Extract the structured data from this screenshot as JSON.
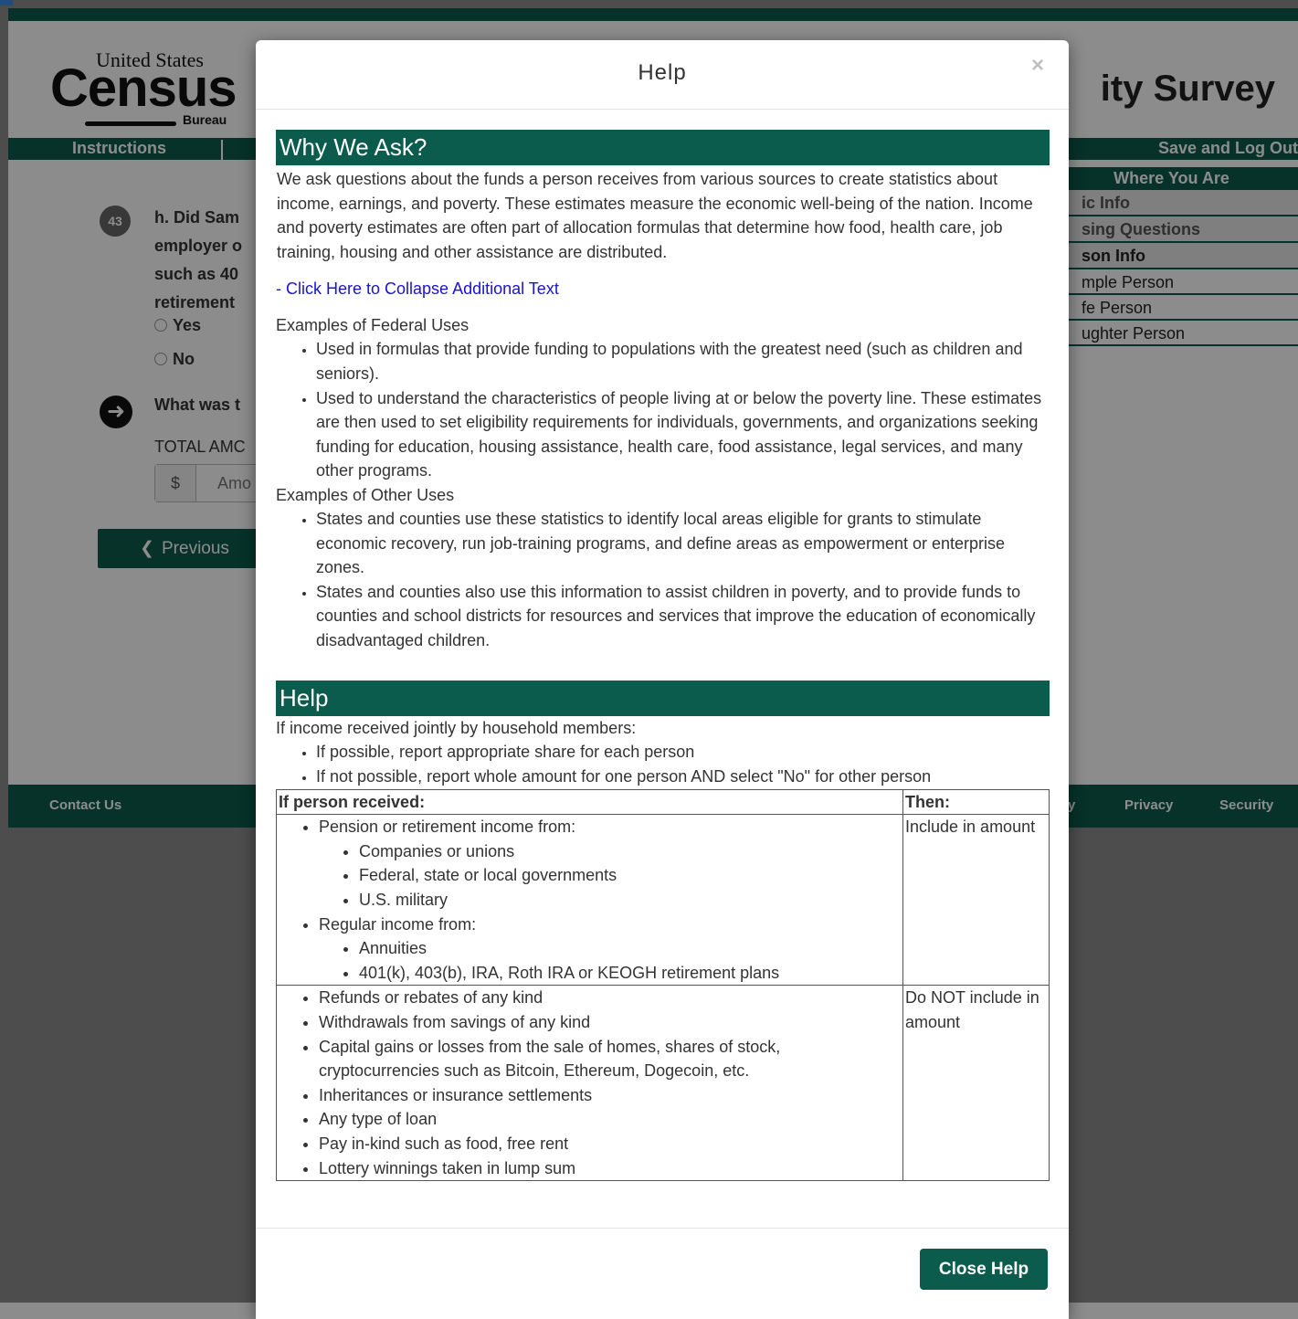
{
  "background": {
    "logo": {
      "top": "United States",
      "main": "Census",
      "bottom": "Bureau"
    },
    "survey_title_visible": "ity Survey",
    "nav": {
      "instructions": "Instructions",
      "save_logout": "Save and Log Out"
    },
    "where_you_are": {
      "heading": "Where You Are",
      "items": [
        {
          "label": "ic Info",
          "style": "bold-muted"
        },
        {
          "label": "sing Questions",
          "style": "bold-muted"
        },
        {
          "label": "son Info",
          "style": "bold"
        },
        {
          "label": "mple Person",
          "style": "plain"
        },
        {
          "label": "fe Person",
          "style": "plain"
        },
        {
          "label": "ughter Person",
          "style": "plain"
        }
      ]
    },
    "question": {
      "number": "43",
      "lines": [
        "h. Did Sam",
        "employer o",
        "such as 40",
        "retirement"
      ],
      "options": [
        "Yes",
        "No"
      ]
    },
    "followup": {
      "text": "What was t",
      "total_label": "TOTAL AMC",
      "currency": "$",
      "placeholder": "Amo"
    },
    "previous_button": "Previous",
    "footer": {
      "contact": "Contact Us",
      "partial": "y",
      "privacy": "Privacy",
      "security": "Security"
    }
  },
  "modal": {
    "title": "Help",
    "close_symbol": "×",
    "why_heading": "Why We Ask?",
    "why_text": "We ask questions about the funds a person receives from various sources to create statistics about income, earnings, and poverty. These estimates measure the economic well-being of the nation. Income and poverty estimates are often part of allocation formulas that determine how food, health care, job training, housing and other assistance are distributed.",
    "collapse_link": "- Click Here to Collapse Additional Text",
    "federal_heading": "Examples of Federal Uses",
    "federal_uses": [
      "Used in formulas that provide funding to populations with the greatest need (such as children and seniors).",
      "Used to understand the characteristics of people living at or below the poverty line. These estimates are then used to set eligibility requirements for individuals, governments, and organizations seeking funding for education, housing assistance, health care, food assistance, legal services, and many other programs."
    ],
    "other_heading": "Examples of Other Uses",
    "other_uses": [
      "States and counties use these statistics to identify local areas eligible for grants to stimulate economic recovery, run job-training programs, and define areas as empowerment or enterprise zones.",
      "States and counties also use this information to assist children in poverty, and to provide funds to counties and school districts for resources and services that improve the education of economically disadvantaged children."
    ],
    "help_heading": "Help",
    "help_intro": "If income received jointly by household members:",
    "help_bullets": [
      "If possible, report appropriate share for each person",
      "If not possible, report whole amount for one person AND select \"No\" for other person"
    ],
    "table": {
      "header": {
        "col1": "If person received:",
        "col2": "Then:"
      },
      "row1": {
        "pension_label": "Pension or retirement income from:",
        "pension_items": [
          "Companies or unions",
          "Federal, state or local governments",
          "U.S. military"
        ],
        "regular_label": "Regular income from:",
        "regular_items": [
          "Annuities",
          "401(k), 403(b), IRA, Roth IRA or KEOGH retirement plans"
        ],
        "then": "Include in amount"
      },
      "row2": {
        "items": [
          "Refunds or rebates of any kind",
          "Withdrawals from savings of any kind",
          "Capital gains or losses from the sale of homes, shares of stock, cryptocurrencies such as Bitcoin, Ethereum, Dogecoin, etc.",
          "Inheritances or insurance settlements",
          "Any type of loan",
          "Pay in-kind such as food, free rent",
          "Lottery winnings taken in lump sum"
        ],
        "then": "Do NOT include in amount"
      }
    },
    "close_button": "Close Help"
  },
  "colors": {
    "brand_green": "#0b5c4c",
    "link_blue": "#1a12d6"
  }
}
